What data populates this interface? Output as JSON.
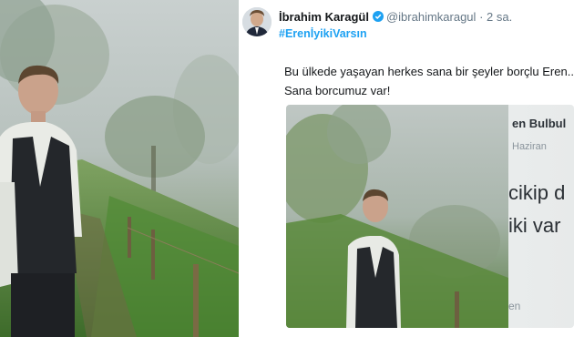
{
  "tweet": {
    "display_name": "İbrahim Karagül",
    "handle": "@ibrahimkaragul",
    "separator": "·",
    "time": "2 sa.",
    "hashtag": "#ErenİyikiVarsın",
    "text_line1": "Bu ülkede yaşayan herkes sana bir şeyler borçlu Eren..",
    "text_line2": "Sana borcumuz var!",
    "verified_icon": "verified-badge-icon",
    "accent_color": "#1da1f2"
  },
  "embedded_card": {
    "name_fragment": "en Bulbul",
    "date_fragment": "Haziran",
    "text_fragment1": "cikip d",
    "text_fragment2": "iki var",
    "bottom_fragment": "en"
  }
}
